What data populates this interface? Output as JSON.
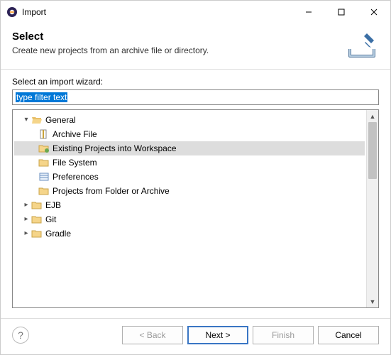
{
  "window": {
    "title": "Import"
  },
  "header": {
    "title": "Select",
    "subtitle": "Create new projects from an archive file or directory."
  },
  "wizard": {
    "label": "Select an import wizard:",
    "filter_text": "type filter text"
  },
  "tree": {
    "nodes": [
      {
        "label": "General",
        "expanded": true,
        "children": [
          {
            "label": "Archive File",
            "icon": "archive"
          },
          {
            "label": "Existing Projects into Workspace",
            "icon": "projects",
            "selected": true
          },
          {
            "label": "File System",
            "icon": "folder"
          },
          {
            "label": "Preferences",
            "icon": "prefs"
          },
          {
            "label": "Projects from Folder or Archive",
            "icon": "folder"
          }
        ]
      },
      {
        "label": "EJB",
        "expanded": false
      },
      {
        "label": "Git",
        "expanded": false
      },
      {
        "label": "Gradle",
        "expanded": false
      }
    ]
  },
  "buttons": {
    "back": "< Back",
    "next": "Next >",
    "finish": "Finish",
    "cancel": "Cancel"
  }
}
